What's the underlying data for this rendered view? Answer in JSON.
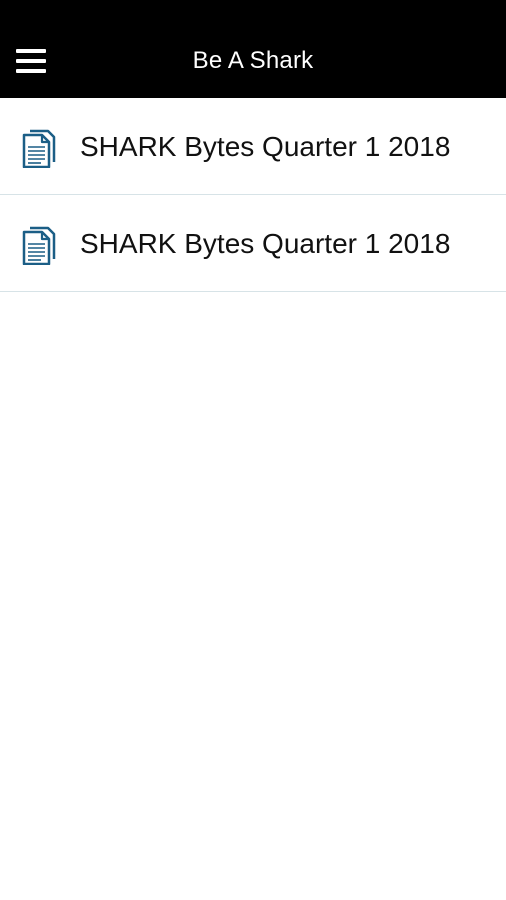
{
  "header": {
    "menu_icon": "hamburger-menu-icon",
    "title": "Be A Shark"
  },
  "list": {
    "items": [
      {
        "label": "SHARK Bytes Quarter 1 2018",
        "icon": "document-icon"
      },
      {
        "label": "SHARK Bytes Quarter 1 2018",
        "icon": "document-icon"
      }
    ]
  },
  "colors": {
    "header_bg": "#000000",
    "header_text": "#ffffff",
    "icon": "#1b5e86",
    "divider": "#d7e3e7",
    "text": "#111111"
  }
}
